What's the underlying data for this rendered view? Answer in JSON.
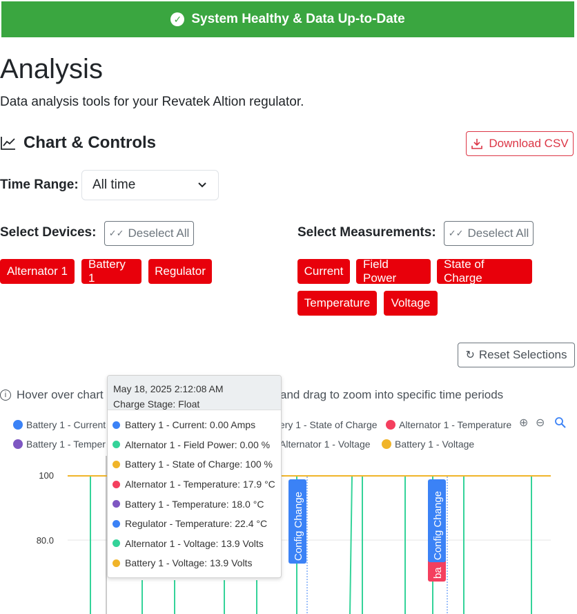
{
  "banner": {
    "text": "System Healthy & Data Up-to-Date",
    "icon": "check-circle-icon"
  },
  "page": {
    "title": "Analysis",
    "subtitle": "Data analysis tools for your Revatek Altion regulator."
  },
  "section": {
    "title": "Chart & Controls",
    "icon": "line-chart-icon"
  },
  "download_label": "Download CSV",
  "time_range": {
    "label": "Time Range:",
    "value": "All time"
  },
  "devices": {
    "label": "Select Devices:",
    "deselect_label": "Deselect All",
    "items": [
      "Alternator 1",
      "Battery 1",
      "Regulator"
    ]
  },
  "measurements": {
    "label": "Select Measurements:",
    "deselect_label": "Deselect All",
    "items": [
      "Current",
      "Field Power",
      "State of Charge",
      "Temperature",
      "Voltage"
    ]
  },
  "reset_label": "Reset Selections",
  "hint": {
    "before": "Hover over chart ",
    "after": "and drag to zoom into specific time periods"
  },
  "legend": [
    {
      "label": "Battery 1 - Current",
      "color": "#3b82f6"
    },
    {
      "label": "Battery 1 - State of Charge",
      "color": "#f59e0b"
    },
    {
      "label": "Alternator 1 - Temperature",
      "color": "#f43f5e"
    },
    {
      "label": "Battery 1 - Temper",
      "color": "#7e57c2"
    },
    {
      "label": "Alternator 1 - Voltage",
      "color": "#34d399"
    },
    {
      "label": "Battery 1 - Voltage",
      "color": "#f0b429"
    }
  ],
  "tooltip": {
    "date": "May 18, 2025 2:12:08 AM",
    "stage": "Charge Stage: Float",
    "rows": [
      {
        "text": "Battery 1 - Current: 0.00 Amps",
        "color": "#3b82f6"
      },
      {
        "text": "Alternator 1 - Field Power: 0.00 %",
        "color": "#34d399"
      },
      {
        "text": "Battery 1 - State of Charge: 100 %",
        "color": "#f0b429"
      },
      {
        "text": "Alternator 1 - Temperature: 17.9 °C",
        "color": "#f43f5e"
      },
      {
        "text": "Battery 1 - Temperature: 18.0 °C",
        "color": "#7e57c2"
      },
      {
        "text": "Regulator - Temperature: 22.4 °C",
        "color": "#3b82f6"
      },
      {
        "text": "Alternator 1 - Voltage: 13.9 Volts",
        "color": "#34d399"
      },
      {
        "text": "Battery 1 - Voltage: 13.9 Volts",
        "color": "#f0b429"
      }
    ]
  },
  "chart_data": {
    "type": "line",
    "y_ticks": [
      "100",
      "80.0"
    ],
    "annotations": [
      "Config Change",
      "Config Change"
    ],
    "annotation_partial": "ba",
    "colors": {
      "soc": "#f0b429",
      "spikes": "#34d399",
      "annotation": "#3b82f6"
    }
  }
}
